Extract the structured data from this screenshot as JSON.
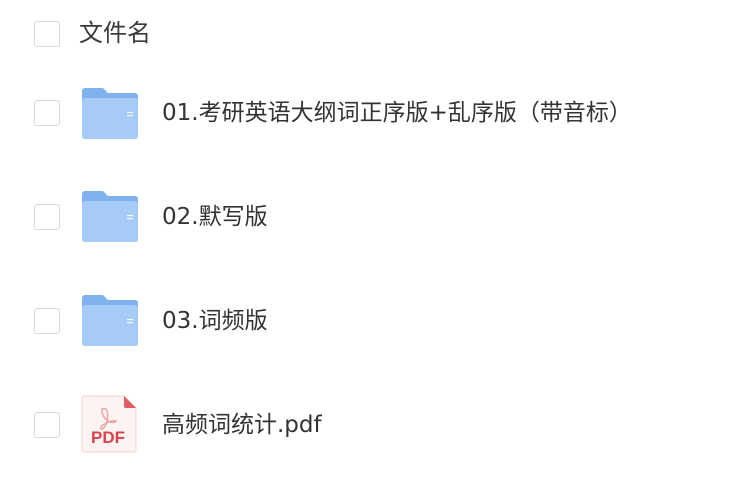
{
  "header": {
    "name_column_label": "文件名"
  },
  "files": [
    {
      "name": "01.考研英语大纲词正序版+乱序版（带音标）",
      "type": "folder",
      "icon": "folder-icon"
    },
    {
      "name": "02.默写版",
      "type": "folder",
      "icon": "folder-icon"
    },
    {
      "name": "03.词频版",
      "type": "folder",
      "icon": "folder-icon"
    },
    {
      "name": "高频词统计.pdf",
      "type": "pdf",
      "icon": "pdf-icon",
      "icon_label": "PDF"
    }
  ],
  "colors": {
    "folder_back": "#7fb2ef",
    "folder_front": "#a3c9f5",
    "pdf_accent": "#d9434b",
    "checkbox_border": "#d9d9d9"
  }
}
